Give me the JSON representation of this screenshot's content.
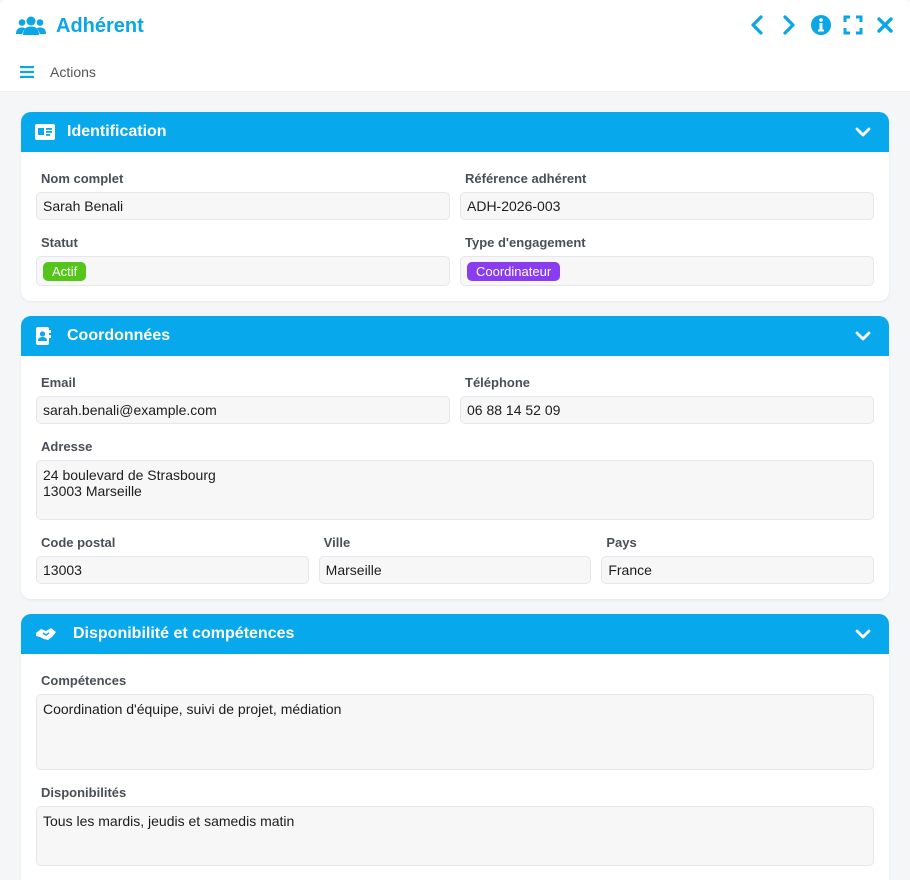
{
  "window": {
    "title": "Adhérent"
  },
  "toolbar": {
    "actions_label": "Actions"
  },
  "sections": {
    "identification": {
      "title": "Identification",
      "nom_label": "Nom complet",
      "nom_value": "Sarah Benali",
      "ref_label": "Référence adhérent",
      "ref_value": "ADH-2026-003",
      "statut_label": "Statut",
      "statut_value": "Actif",
      "type_label": "Type d'engagement",
      "type_value": "Coordinateur"
    },
    "coordonnees": {
      "title": "Coordonnées",
      "email_label": "Email",
      "email_value": "sarah.benali@example.com",
      "tel_label": "Téléphone",
      "tel_value": "06 88 14 52 09",
      "adresse_label": "Adresse",
      "adresse_value": "24 boulevard de Strasbourg\n13003 Marseille",
      "cp_label": "Code postal",
      "cp_value": "13003",
      "ville_label": "Ville",
      "ville_value": "Marseille",
      "pays_label": "Pays",
      "pays_value": "France"
    },
    "disponibilite": {
      "title": "Disponibilité et compétences",
      "competences_label": "Compétences",
      "competences_value": "Coordination d'équipe, suivi de projet, médiation",
      "dispo_label": "Disponibilités",
      "dispo_value": "Tous les mardis, jeudis et samedis matin"
    }
  },
  "colors": {
    "accent": "#07a9ec",
    "badge_actif": "#55c51a",
    "badge_coordinateur": "#8a3cf0"
  },
  "icons": {
    "app": "users-icon",
    "prev": "chevron-left-icon",
    "next": "chevron-right-icon",
    "info": "info-icon",
    "fullscreen": "expand-icon",
    "close": "close-icon",
    "menu": "hamburger-icon",
    "identification": "id-card-icon",
    "coordonnees": "address-book-icon",
    "disponibilite": "handshake-icon",
    "collapse": "chevron-down-icon"
  }
}
